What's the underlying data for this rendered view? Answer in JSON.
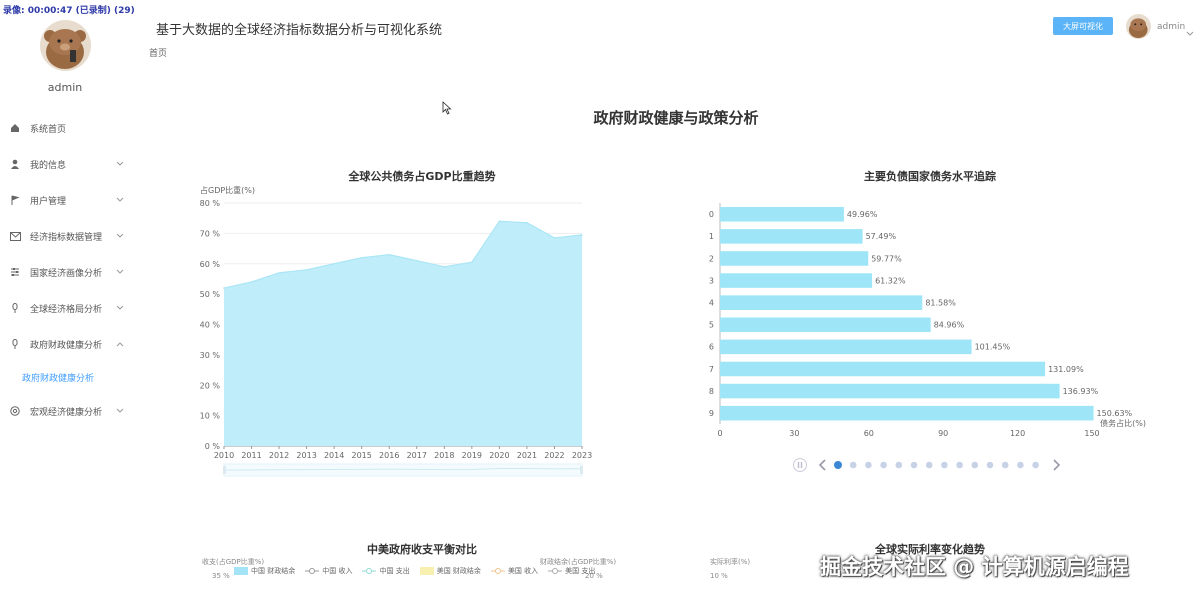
{
  "recorder_overlay": "录像: 00:00:47 (已录制) (29)",
  "app": {
    "title": "基于大数据的全球经济指标数据分析与可视化系统",
    "breadcrumb": "首页",
    "bigscreen_button": "大屏可视化",
    "user": "admin"
  },
  "sidebar": {
    "user": "admin",
    "items": [
      {
        "label": "系统首页",
        "icon": "home-icon"
      },
      {
        "label": "我的信息",
        "icon": "user-icon"
      },
      {
        "label": "用户管理",
        "icon": "flag-icon"
      },
      {
        "label": "经济指标数据管理",
        "icon": "mail-icon"
      },
      {
        "label": "国家经济画像分析",
        "icon": "sliders-icon"
      },
      {
        "label": "全球经济格局分析",
        "icon": "microphone-icon"
      },
      {
        "label": "政府财政健康分析",
        "icon": "microphone-icon"
      },
      {
        "label": "宏观经济健康分析",
        "icon": "globe-icon"
      }
    ],
    "active_subitem": "政府财政健康分析"
  },
  "page_title": "政府财政健康与政策分析",
  "charts": {
    "debt_trend": {
      "title": "全球公共债务占GDP比重趋势",
      "ylabel": "占GDP比重(%)"
    },
    "debt_ranking": {
      "title": "主要负债国家债务水平追踪",
      "xlabel": "债务占比(%)"
    },
    "balance": {
      "title": "中美政府收支平衡对比",
      "ylabel_left": "收支(占GDP比重%)",
      "ylabel_right": "财政结余(占GDP比重%)",
      "tick_left": "35 %",
      "tick_right": "20 %"
    },
    "interest": {
      "title": "全球实际利率变化趋势",
      "ylabel": "实际利率(%)",
      "tick": "10 %"
    }
  },
  "legend": [
    {
      "label": "中国 财政结余",
      "color": "#a5e3f6",
      "shape": "rect"
    },
    {
      "label": "中国 收入",
      "color": "#999999",
      "shape": "circle"
    },
    {
      "label": "中国 支出",
      "color": "#8edbd4",
      "shape": "circle"
    },
    {
      "label": "美国 财政结余",
      "color": "#f7f0b0",
      "shape": "rect"
    },
    {
      "label": "美国 收入",
      "color": "#f1c38d",
      "shape": "circle"
    },
    {
      "label": "美国 支出",
      "color": "#aaaaaa",
      "shape": "circle"
    }
  ],
  "watermark": "掘金技术社区 @ 计算机源启编程",
  "chart_data": [
    {
      "type": "area",
      "title": "全球公共债务占GDP比重趋势",
      "ylabel": "占GDP比重(%)",
      "x": [
        2010,
        2011,
        2012,
        2013,
        2014,
        2015,
        2016,
        2017,
        2018,
        2019,
        2020,
        2021,
        2022,
        2023
      ],
      "y": [
        52,
        54,
        57,
        58,
        60,
        62,
        63,
        61,
        59,
        60.5,
        74,
        73.5,
        68.5,
        69.5
      ],
      "ylim": [
        0,
        80
      ],
      "yticks": [
        "0 %",
        "10 %",
        "20 %",
        "30 %",
        "40 %",
        "50 %",
        "60 %",
        "70 %",
        "80 %"
      ],
      "color": "#bfedf9"
    },
    {
      "type": "bar",
      "orientation": "horizontal",
      "title": "主要负债国家债务水平追踪",
      "xlabel": "债务占比(%)",
      "categories": [
        "0",
        "1",
        "2",
        "3",
        "4",
        "5",
        "6",
        "7",
        "8",
        "9"
      ],
      "values": [
        49.96,
        57.49,
        59.77,
        61.32,
        81.58,
        84.96,
        101.45,
        131.09,
        136.93,
        150.63
      ],
      "labels": [
        "49.96%",
        "57.49%",
        "59.77%",
        "61.32%",
        "81.58%",
        "84.96%",
        "101.45%",
        "131.09%",
        "136.93%",
        "150.63%"
      ],
      "xlim": [
        0,
        150
      ],
      "xticks": [
        0,
        30,
        60,
        90,
        120,
        150
      ],
      "color": "#9ee6f7"
    }
  ]
}
